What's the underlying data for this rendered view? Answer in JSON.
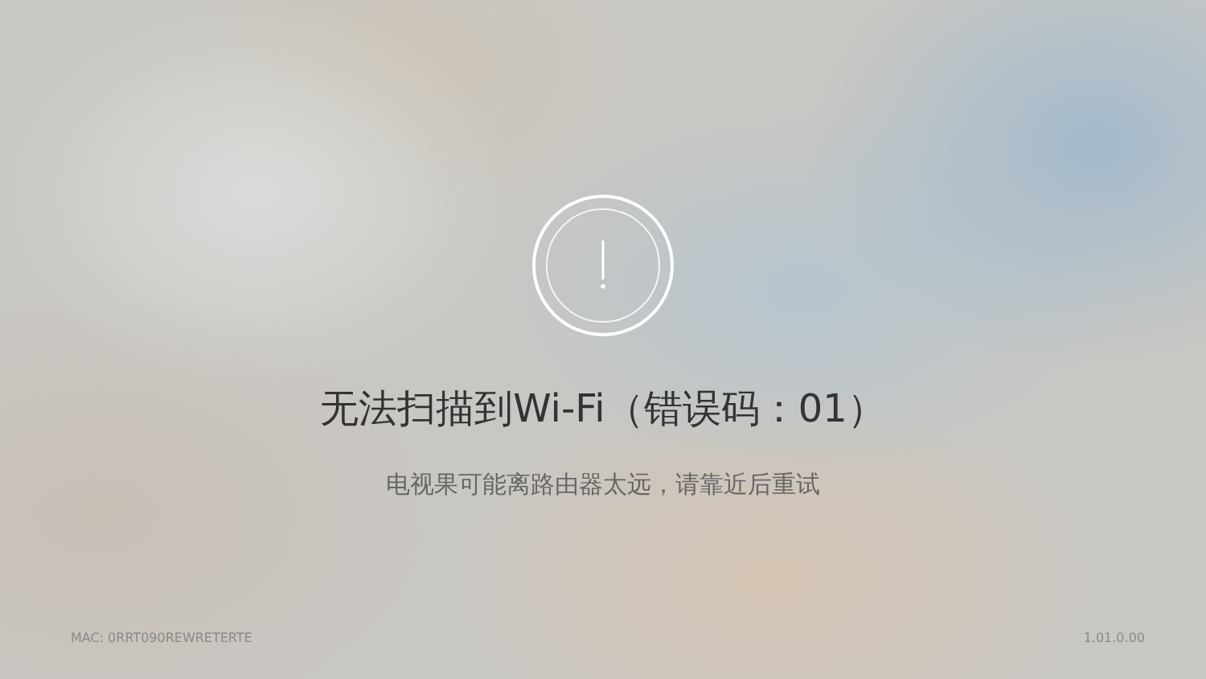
{
  "error": {
    "title": "无法扫描到Wi-Fi（错误码：01）",
    "message": "电视果可能离路由器太远，请靠近后重试"
  },
  "footer": {
    "mac": "MAC:  0RRT090REWRETERTE",
    "version": "1.01.0.00"
  }
}
